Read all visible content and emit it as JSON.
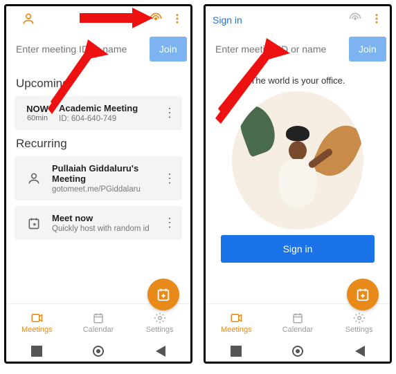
{
  "left": {
    "topbar": {
      "profile_icon": "profile",
      "cast_icon": "cast",
      "menu_icon": "more"
    },
    "search": {
      "placeholder": "Enter meeting ID or name",
      "join_label": "Join"
    },
    "sections": {
      "upcoming_title": "Upcoming",
      "recurring_title": "Recurring"
    },
    "upcoming": {
      "now_label": "NOW",
      "duration": "60min",
      "title": "Academic Meeting",
      "id_label": "ID: 604-640-749"
    },
    "recurring": [
      {
        "title": "Pullaiah Giddaluru's Meeting",
        "sub": "gotomeet.me/PGiddalaru"
      },
      {
        "title": "Meet now",
        "sub": "Quickly host with random id"
      }
    ],
    "nav": {
      "meetings": "Meetings",
      "calendar": "Calendar",
      "settings": "Settings"
    }
  },
  "right": {
    "signin": "Sign in",
    "search": {
      "placeholder": "Enter meeting ID or name",
      "join_label": "Join"
    },
    "tagline": "The world is your office.",
    "signin_button": "Sign in",
    "nav": {
      "meetings": "Meetings",
      "calendar": "Calendar",
      "settings": "Settings"
    }
  }
}
